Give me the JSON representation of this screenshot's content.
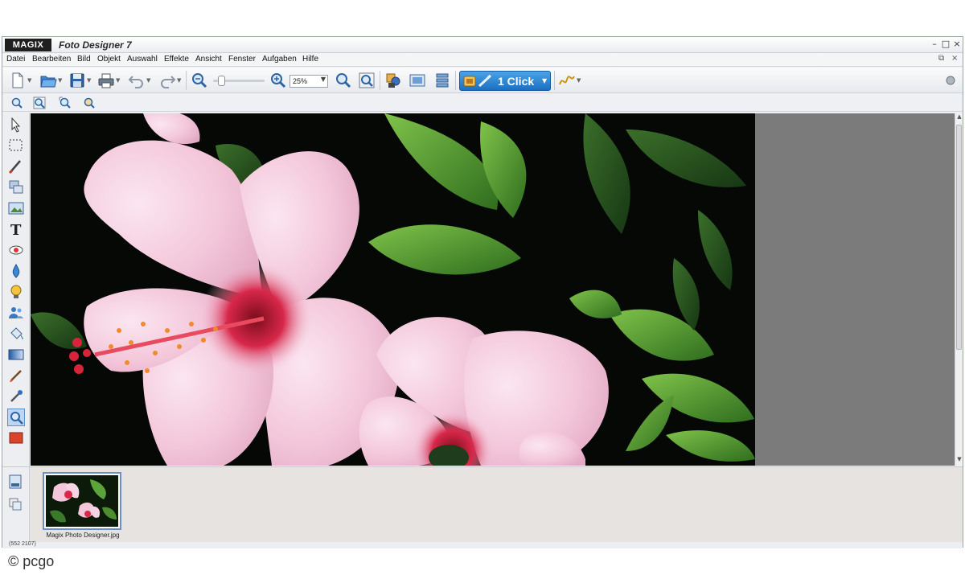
{
  "window": {
    "brand": "MAGIX",
    "title": "Foto Designer 7",
    "controls": {
      "minimize": "–",
      "maximize": "□",
      "close": "×"
    },
    "mdi_controls": {
      "restore": "⧉",
      "close": "×"
    }
  },
  "menu": [
    "Datei",
    "Bearbeiten",
    "Bild",
    "Objekt",
    "Auswahl",
    "Effekte",
    "Ansicht",
    "Fenster",
    "Aufgaben",
    "Hilfe"
  ],
  "toolbar": {
    "zoom_value": "25%",
    "one_click_label": "1 Click",
    "icons": [
      "new-file-icon",
      "open-folder-icon",
      "save-icon",
      "print-icon",
      "undo-icon",
      "redo-icon",
      "zoom-out-icon",
      "zoom-in-icon",
      "zoom-100-icon",
      "fit-window-icon",
      "object-manager-icon",
      "media-pool-icon",
      "layers-icon",
      "one-click-icon",
      "signature-icon",
      "help-icon"
    ]
  },
  "toolbar2": {
    "icons": [
      "view-icon-1",
      "view-icon-2",
      "view-icon-3",
      "view-icon-4"
    ]
  },
  "toolbox": {
    "tools": [
      "pointer-tool-icon",
      "rectangle-select-icon",
      "brush-icon",
      "clone-icon",
      "image-object-icon",
      "text-tool-icon",
      "red-eye-icon",
      "blur-drop-icon",
      "bulb-icon",
      "people-icon",
      "fill-icon",
      "gradient-icon",
      "paintbrush-icon",
      "pipette-icon",
      "zoom-tool-icon",
      "color-swatch-icon"
    ],
    "active": "zoom-tool-icon",
    "swatch_color": "#d9442a",
    "text_tool_label": "T"
  },
  "filmstrip": {
    "items": [
      {
        "label": "Magix Photo Designer.jpg"
      }
    ]
  },
  "statusbar": {
    "text": "(552 2107)"
  },
  "watermark": {
    "text": "© pcgo"
  }
}
